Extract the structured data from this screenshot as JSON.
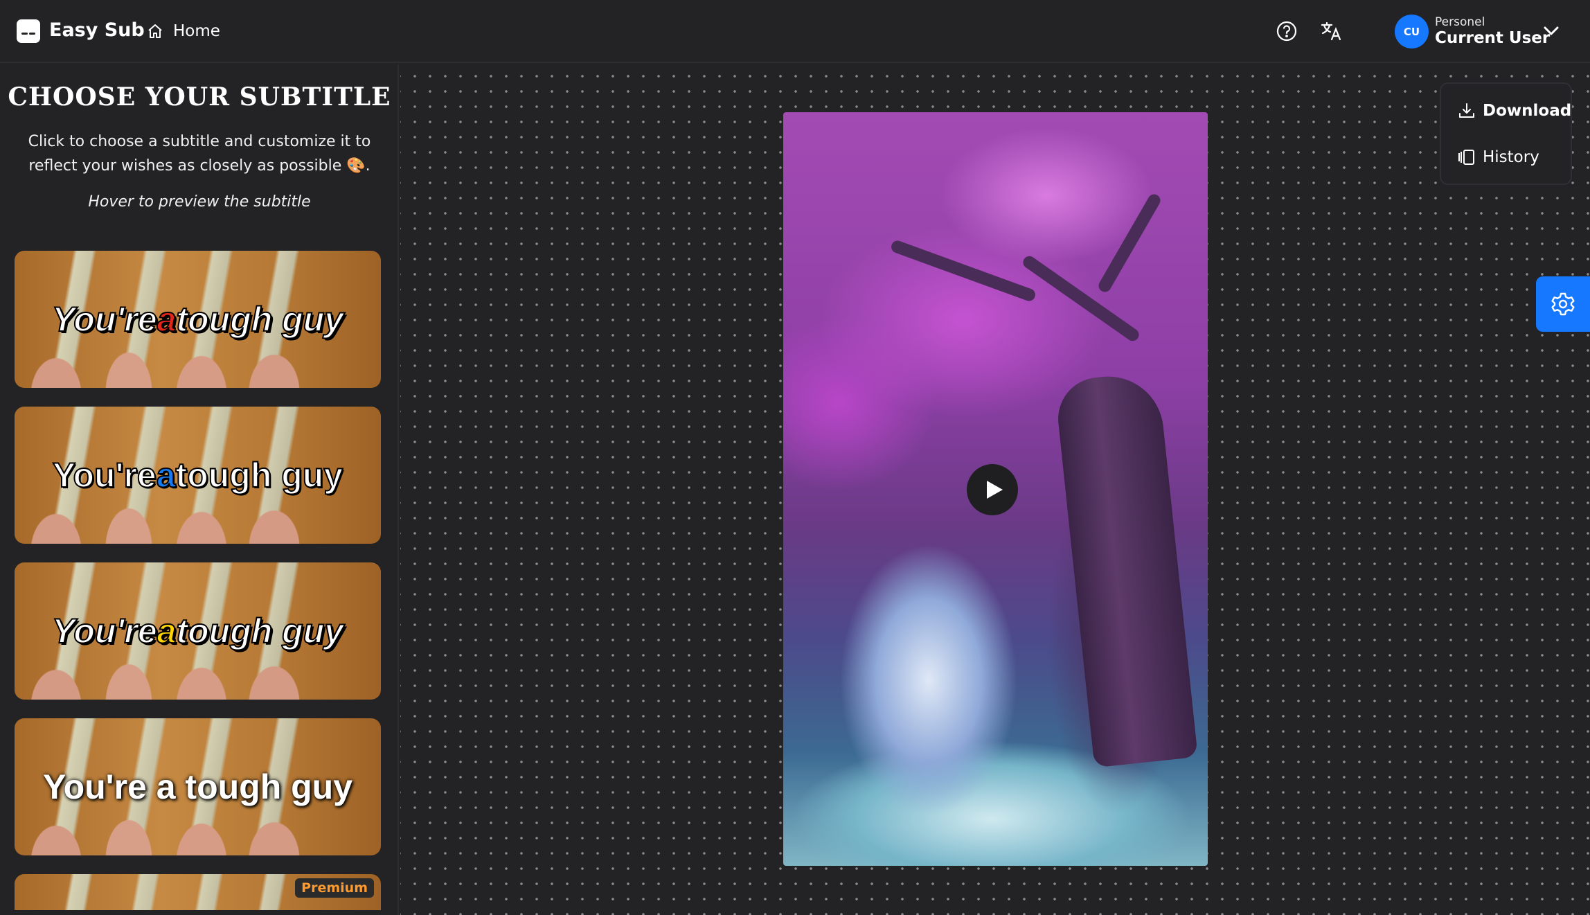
{
  "app": {
    "name": "Easy Sub"
  },
  "nav": {
    "home_label": "Home"
  },
  "user": {
    "initials": "CU",
    "plan": "Personel",
    "name": "Current User"
  },
  "sidebar": {
    "title": "CHOOSE YOUR SUBTITLE",
    "description": "Click to choose a subtitle and customize it to reflect your wishes as closely as possible 🎨.",
    "hint": "Hover to preview the subtitle",
    "cards": [
      {
        "pre": "You're ",
        "highlight": "a",
        "post": " tough guy",
        "highlight_color": "#e3261b"
      },
      {
        "pre": "You're ",
        "highlight": "a",
        "post": " tough guy",
        "highlight_color": "#1a7bf0"
      },
      {
        "pre": "You're ",
        "highlight": "a",
        "post": " tough guy",
        "highlight_color": "#ffd400"
      },
      {
        "pre": "You're a tough guy",
        "highlight": "",
        "post": ""
      }
    ],
    "premium_label": "Premium"
  },
  "actions": {
    "download_label": "Download",
    "history_label": "History"
  },
  "icons": [
    "logo-icon",
    "home-icon",
    "help-icon",
    "translate-icon",
    "chevron-down-icon",
    "download-icon",
    "history-icon",
    "play-icon",
    "settings-icon"
  ],
  "colors": {
    "accent": "#1677ff",
    "premium": "#ff9a2e",
    "background": "#232325"
  }
}
